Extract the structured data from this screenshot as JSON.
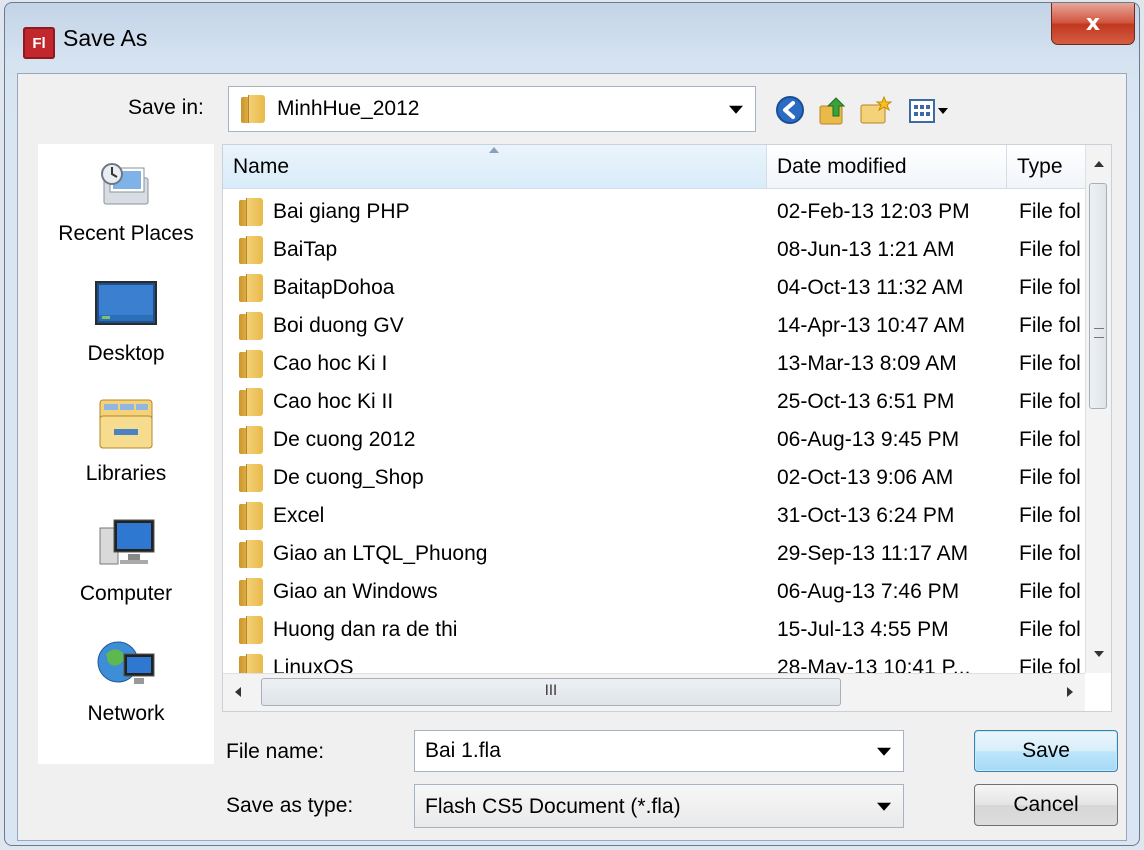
{
  "dialog": {
    "title": "Save As",
    "app_icon_text": "Fl",
    "close_symbol": "x"
  },
  "location": {
    "label": "Save in:",
    "current_folder": "MinhHue_2012"
  },
  "toolbar": {
    "back": "back-arrow-icon",
    "up": "up-folder-icon",
    "new_folder": "new-folder-icon",
    "views": "view-menu-icon"
  },
  "places": [
    {
      "label": "Recent Places",
      "icon": "recent-places-icon"
    },
    {
      "label": "Desktop",
      "icon": "desktop-icon"
    },
    {
      "label": "Libraries",
      "icon": "libraries-icon"
    },
    {
      "label": "Computer",
      "icon": "computer-icon"
    },
    {
      "label": "Network",
      "icon": "network-icon"
    }
  ],
  "columns": {
    "name": "Name",
    "date": "Date modified",
    "type": "Type"
  },
  "files": [
    {
      "name": "Bai giang PHP",
      "date": "02-Feb-13 12:03 PM",
      "type": "File fol"
    },
    {
      "name": "BaiTap",
      "date": "08-Jun-13 1:21 AM",
      "type": "File fol"
    },
    {
      "name": "BaitapDohoa",
      "date": "04-Oct-13 11:32 AM",
      "type": "File fol"
    },
    {
      "name": "Boi duong GV",
      "date": "14-Apr-13 10:47 AM",
      "type": "File fol"
    },
    {
      "name": "Cao hoc Ki I",
      "date": "13-Mar-13 8:09 AM",
      "type": "File fol"
    },
    {
      "name": "Cao hoc Ki II",
      "date": "25-Oct-13 6:51 PM",
      "type": "File fol"
    },
    {
      "name": "De cuong 2012",
      "date": "06-Aug-13 9:45 PM",
      "type": "File fol"
    },
    {
      "name": "De cuong_Shop",
      "date": "02-Oct-13 9:06 AM",
      "type": "File fol"
    },
    {
      "name": "Excel",
      "date": "31-Oct-13 6:24 PM",
      "type": "File fol"
    },
    {
      "name": "Giao an LTQL_Phuong",
      "date": "29-Sep-13 11:17 AM",
      "type": "File fol"
    },
    {
      "name": "Giao an Windows",
      "date": "06-Aug-13 7:46 PM",
      "type": "File fol"
    },
    {
      "name": "Huong dan ra de thi",
      "date": "15-Jul-13 4:55 PM",
      "type": "File fol"
    },
    {
      "name": "LinuxOS",
      "date": "28-May-13 10:41 P...",
      "type": "File fol"
    }
  ],
  "hscroll_grip": "III",
  "file_name": {
    "label": "File name:",
    "value": "Bai 1.fla"
  },
  "save_type": {
    "label": "Save as type:",
    "value": "Flash CS5 Document (*.fla)"
  },
  "buttons": {
    "save": "Save",
    "cancel": "Cancel"
  }
}
